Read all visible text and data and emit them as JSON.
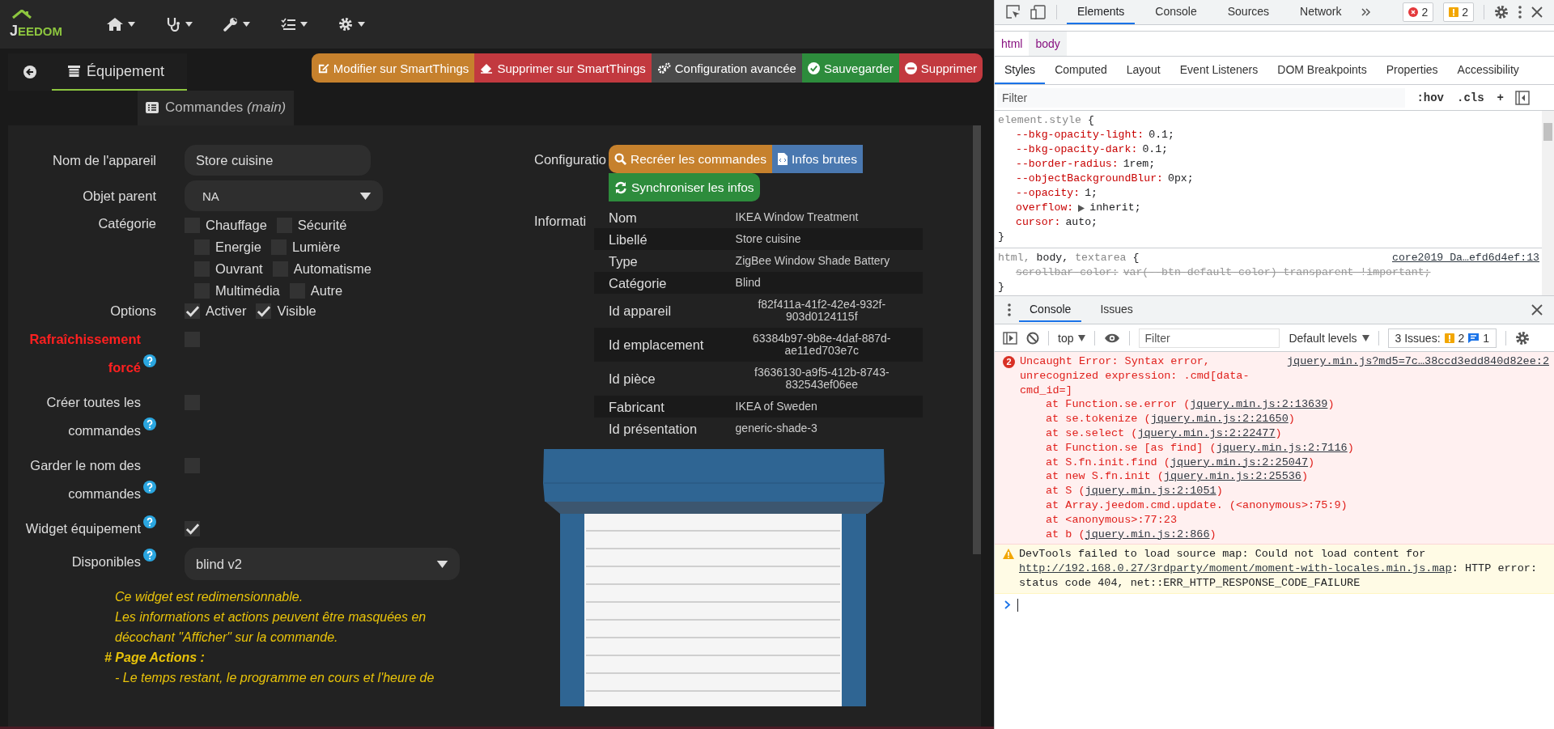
{
  "navbar": {
    "logo_mark": "J",
    "logo_text": "EEDOM",
    "menus": [
      {
        "kind": "home"
      },
      {
        "kind": "health"
      },
      {
        "kind": "tools"
      },
      {
        "kind": "tasks"
      },
      {
        "kind": "settings"
      }
    ]
  },
  "tabs": [
    {
      "label": "Équipement",
      "selected": true
    },
    {
      "label": "Commandes *(main)*",
      "selected": false
    }
  ],
  "actions": [
    {
      "label": "Modifier sur SmartThings",
      "color": "#c6812d"
    },
    {
      "label": "Supprimer sur SmartThings",
      "color": "#c2393f"
    },
    {
      "label": "Configuration avancée",
      "color": "#4a4a4a"
    },
    {
      "label": "Sauvegarder",
      "color": "#2d8c3c"
    },
    {
      "label": "Supprimer",
      "color": "#c2393f"
    }
  ],
  "form": {
    "fields": [
      {
        "kind": "text",
        "label": "Nom de l'appareil",
        "value": "Store cuisine"
      },
      {
        "kind": "select",
        "label": "Objet parent",
        "value": "NA"
      }
    ],
    "category": {
      "label": "Catégorie",
      "rows": [
        [
          {
            "label": "Chauffage",
            "checked": false
          },
          {
            "label": "Sécurité",
            "checked": false
          }
        ],
        [
          {
            "label": "Energie",
            "checked": false
          },
          {
            "label": "Lumière",
            "checked": false
          }
        ],
        [
          {
            "label": "Ouvrant",
            "checked": false
          },
          {
            "label": "Automatisme",
            "checked": false
          }
        ],
        [
          {
            "label": "Multimédia",
            "checked": false
          },
          {
            "label": "Autre",
            "checked": false
          }
        ]
      ]
    },
    "options": {
      "label": "Options",
      "items": [
        {
          "label": "Activer",
          "checked": true
        },
        {
          "label": "Visible",
          "checked": true
        }
      ]
    },
    "toggles": [
      {
        "label": "Rafraîchissement forcé",
        "warning": true,
        "checked": false
      },
      {
        "label": "Créer toutes les commandes",
        "warning": false,
        "checked": false
      },
      {
        "label": "Garder le nom des commandes",
        "warning": false,
        "checked": false
      },
      {
        "label": "Widget équipement",
        "warning": false,
        "checked": true
      }
    ],
    "widget": {
      "label": "Disponibles",
      "value": "blind v2",
      "notes": [
        {
          "kind": "text",
          "text": "Ce widget est redimensionnable."
        },
        {
          "kind": "text",
          "text": "Les informations et actions peuvent être masquées en décochant \"Afficher\" sur la commande."
        },
        {
          "kind": "heading",
          "text": "# Page Actions :"
        },
        {
          "kind": "text",
          "text": "- Le temps restant, le programme en cours et l'heure de"
        }
      ]
    }
  },
  "config": {
    "label": "Configuratio",
    "buttons": [
      {
        "label": "Recréer les commandes",
        "color": "#c6812d"
      },
      {
        "label": "Infos brutes",
        "color": "#4a78b0"
      },
      {
        "label": "Synchroniser les infos",
        "color": "#2d8c3c"
      }
    ]
  },
  "info": {
    "label": "Informati",
    "rows": [
      {
        "kind": "text",
        "label": "Nom",
        "value": "IKEA Window Treatment"
      },
      {
        "kind": "text",
        "label": "Libellé",
        "value": "Store cuisine"
      },
      {
        "kind": "text",
        "label": "Type",
        "value": "ZigBee Window Shade Battery"
      },
      {
        "kind": "text",
        "label": "Catégorie",
        "value": "Blind"
      },
      {
        "kind": "id",
        "label": "Id appareil",
        "value": "f82f411a-41f2-42e4-932f-903d0124115f"
      },
      {
        "kind": "id",
        "label": "Id emplacement",
        "value": "63384b97-9b8e-4daf-887d-ae11ed703e7c"
      },
      {
        "kind": "id",
        "label": "Id pièce",
        "value": "f3636130-a9f5-412b-8743-832543ef06ee"
      },
      {
        "kind": "text",
        "label": "Fabricant",
        "value": "IKEA of Sweden"
      },
      {
        "kind": "text",
        "label": "Id présentation",
        "value": "generic-shade-3"
      }
    ]
  },
  "devtools": {
    "tabs": [
      {
        "label": "Elements",
        "selected": true
      },
      {
        "label": "Console",
        "selected": false
      },
      {
        "label": "Sources",
        "selected": false
      },
      {
        "label": "Network",
        "selected": false
      }
    ],
    "errors": "2",
    "warnings": "2",
    "breadcrumb": [
      {
        "label": "html",
        "selected": false
      },
      {
        "label": "body",
        "selected": true
      }
    ],
    "panes": [
      {
        "label": "Styles",
        "selected": true
      },
      {
        "label": "Computed",
        "selected": false
      },
      {
        "label": "Layout",
        "selected": false
      },
      {
        "label": "Event Listeners",
        "selected": false
      },
      {
        "label": "DOM Breakpoints",
        "selected": false
      },
      {
        "label": "Properties",
        "selected": false
      },
      {
        "label": "Accessibility",
        "selected": false
      }
    ],
    "filter": {
      "placeholder": "Filter"
    },
    "filter_tools": [
      ":hov",
      ".cls",
      "+"
    ],
    "rules": [
      {
        "selector": [
          {
            "text": "element.style",
            "matched": false
          },
          {
            "text": "{",
            "matched": true
          }
        ],
        "close": "}",
        "props": [
          {
            "name": "--bkg-opacity-light:",
            "value": "0.1;",
            "expandable": false,
            "overridden": false
          },
          {
            "name": "--bkg-opacity-dark:",
            "value": "0.1;",
            "expandable": false,
            "overridden": false
          },
          {
            "name": "--border-radius:",
            "value": "1rem;",
            "expandable": false,
            "overridden": false
          },
          {
            "name": "--objectBackgroundBlur:",
            "value": "0px;",
            "expandable": false,
            "overridden": false
          },
          {
            "name": "--opacity:",
            "value": "1;",
            "expandable": false,
            "overridden": false
          },
          {
            "name": "overflow:",
            "value": "inherit;",
            "expandable": true,
            "overridden": false
          },
          {
            "name": "cursor:",
            "value": "auto;",
            "expandable": false,
            "overridden": false
          }
        ]
      },
      {
        "selector": [
          {
            "text": "html,",
            "matched": false
          },
          {
            "text": "body,",
            "matched": true
          },
          {
            "text": "textarea",
            "matched": false
          },
          {
            "text": "{",
            "matched": true
          }
        ],
        "source": "core2019_Da…efd6d4ef:13",
        "close": "}",
        "props": [
          {
            "name": "scrollbar-color:",
            "value": "var(--btn-default-color) transparent !important;",
            "expandable": false,
            "overridden": true
          }
        ]
      }
    ]
  },
  "drawer": {
    "tabs": [
      {
        "label": "Console",
        "selected": true
      },
      {
        "label": "Issues",
        "selected": false
      }
    ],
    "context": "top",
    "filter": {
      "placeholder": "Filter"
    },
    "levels": "Default levels",
    "issues": {
      "label": "3 Issues:",
      "warnings": "2",
      "infos": "1"
    },
    "messages": [
      {
        "kind": "error",
        "count": "2",
        "text": "Uncaught Error: Syntax error, unrecognized expression: .cmd[data-cmd_id=]",
        "source": "jquery.min.js?md5=7c…38ccd3edd840d82ee:2",
        "stack": [
          {
            "prefix": "at Function.se.error (",
            "link": "jquery.min.js:2:13639",
            "suffix": ")"
          },
          {
            "prefix": "at se.tokenize (",
            "link": "jquery.min.js:2:21650",
            "suffix": ")"
          },
          {
            "prefix": "at se.select (",
            "link": "jquery.min.js:2:22477",
            "suffix": ")"
          },
          {
            "prefix": "at Function.se [as find] (",
            "link": "jquery.min.js:2:7116",
            "suffix": ")"
          },
          {
            "prefix": "at S.fn.init.find (",
            "link": "jquery.min.js:2:25047",
            "suffix": ")"
          },
          {
            "prefix": "at new S.fn.init (",
            "link": "jquery.min.js:2:25536",
            "suffix": ")"
          },
          {
            "prefix": "at S (",
            "link": "jquery.min.js:2:1051",
            "suffix": ")"
          },
          {
            "prefix": "at Array.jeedom.cmd.update. (<anonymous>:75:9)"
          },
          {
            "prefix": "at <anonymous>:77:23"
          },
          {
            "prefix": "at b (",
            "link": "jquery.min.js:2:866",
            "suffix": ")"
          }
        ]
      },
      {
        "kind": "warning",
        "text": "DevTools failed to load source map: Could not load content for ",
        "link": "http://192.168.0.27/3rdparty/moment/moment-with-locales.min.js.map",
        "suffix": ": HTTP error: status code 404, net::ERR_HTTP_RESPONSE_CODE_FAILURE"
      }
    ]
  }
}
